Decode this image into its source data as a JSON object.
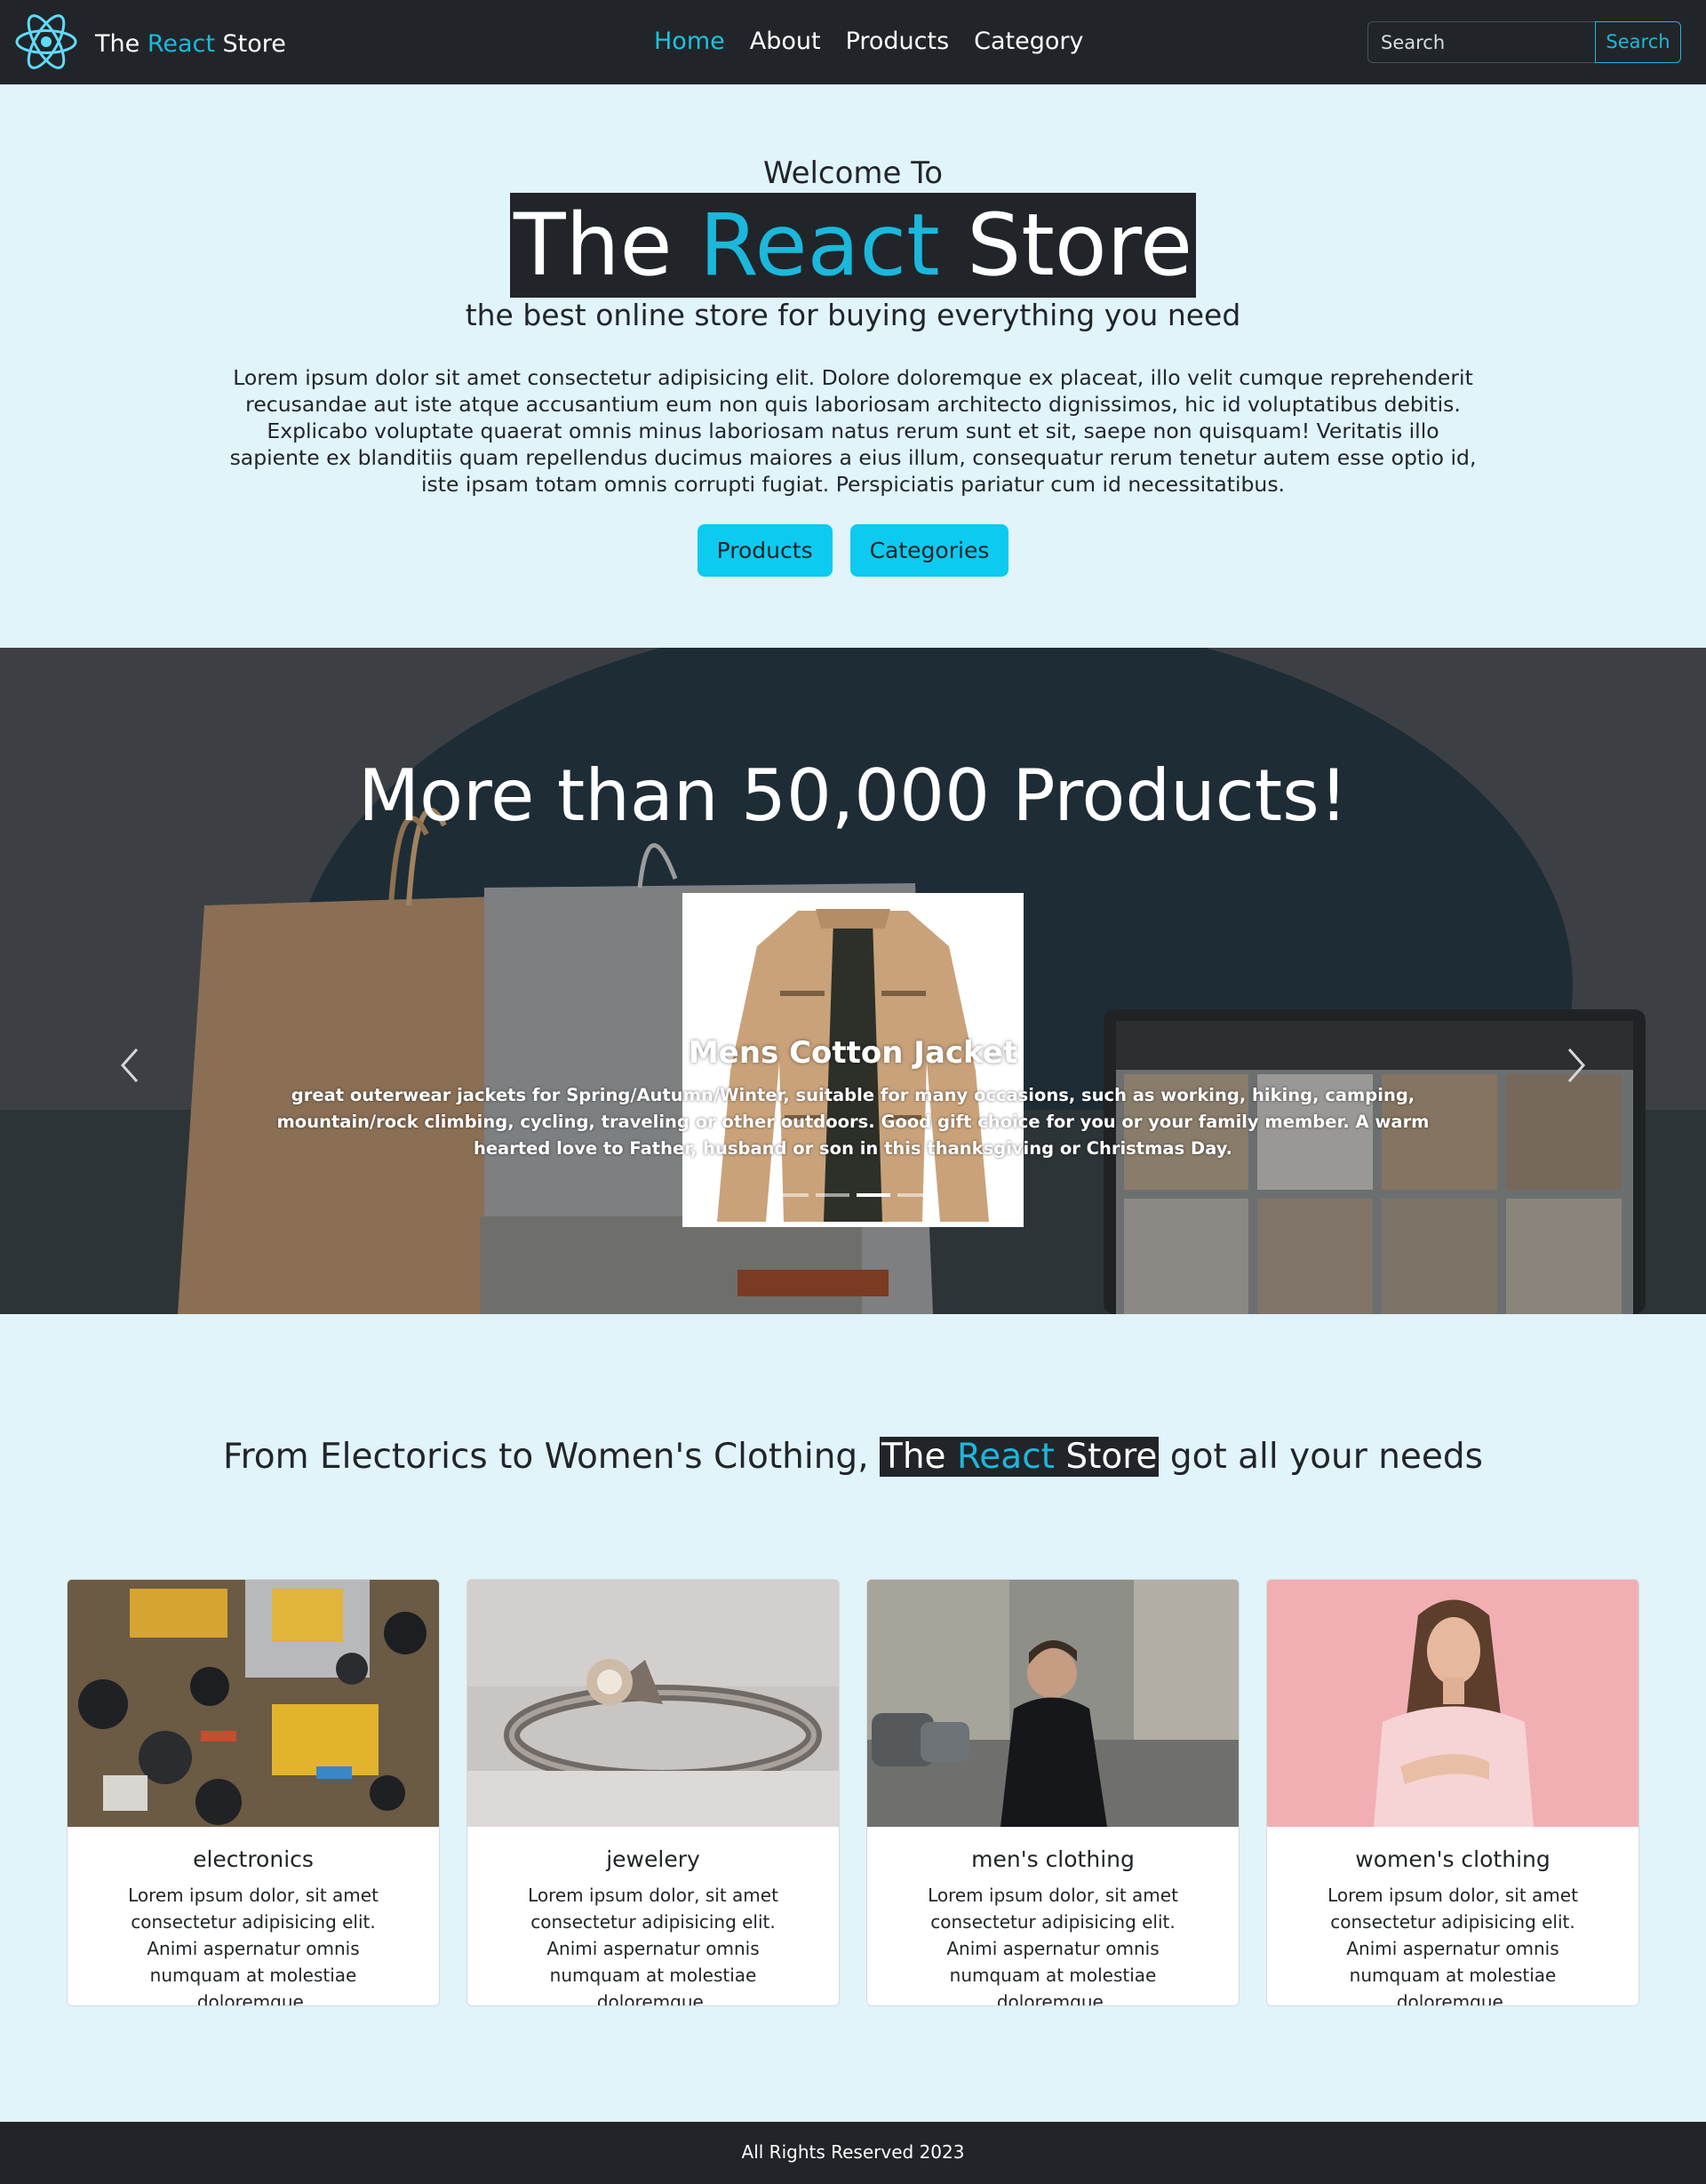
{
  "nav": {
    "brand_prefix": "The",
    "brand_accent": "React",
    "brand_suffix": "Store",
    "links": [
      "Home",
      "About",
      "Products",
      "Category"
    ],
    "search_placeholder": "Search",
    "search_button": "Search"
  },
  "hero": {
    "welcome": "Welcome To",
    "title_prefix": "The",
    "title_accent": "React",
    "title_suffix": "Store",
    "tagline": "the best online store for buying everything you need",
    "body": "Lorem ipsum dolor sit amet consectetur adipisicing elit. Dolore doloremque ex placeat, illo velit cumque reprehenderit recusandae aut iste atque accusantium eum non quis laboriosam architecto dignissimos, hic id voluptatibus debitis. Explicabo voluptate quaerat omnis minus laboriosam natus rerum sunt et sit, saepe non quisquam! Veritatis illo sapiente ex blanditiis quam repellendus ducimus maiores a eius illum, consequatur rerum tenetur autem esse optio id, iste ipsam totam omnis corrupti fugiat. Perspiciatis pariatur cum id necessitatibus.",
    "buttons": [
      "Products",
      "Categories"
    ]
  },
  "showcase": {
    "title": "More than 50,000 Products!",
    "slide_title": "Mens Cotton Jacket",
    "slide_text": "great outerwear jackets for Spring/Autumn/Winter, suitable for many occasions, such as working, hiking, camping, mountain/rock climbing, cycling, traveling or other outdoors. Good gift choice for you or your family member. A warm hearted love to Father, husband or son in this thanksgiving or Christmas Day.",
    "indicators": 4,
    "active_indicator": 3
  },
  "categories": {
    "heading_prefix": "From Electorics to Women's Clothing,",
    "heading_brand_prefix": "The",
    "heading_brand_accent": "React",
    "heading_brand_suffix": "Store",
    "heading_suffix": "got all your needs",
    "items": [
      {
        "title": "electronics",
        "text": "Lorem ipsum dolor, sit amet consectetur adipisicing elit. Animi aspernatur omnis numquam at molestiae doloremque."
      },
      {
        "title": "jewelery",
        "text": "Lorem ipsum dolor, sit amet consectetur adipisicing elit. Animi aspernatur omnis numquam at molestiae doloremque."
      },
      {
        "title": "men's clothing",
        "text": "Lorem ipsum dolor, sit amet consectetur adipisicing elit. Animi aspernatur omnis numquam at molestiae doloremque."
      },
      {
        "title": "women's clothing",
        "text": "Lorem ipsum dolor, sit amet consectetur adipisicing elit. Animi aspernatur omnis numquam at molestiae doloremque."
      }
    ]
  },
  "footer": {
    "text": "All Rights Reserved 2023"
  },
  "colors": {
    "accent": "#1bb8dc",
    "active_nav": "#1bc3dc",
    "button": "#0dcaf0",
    "dark": "#212529",
    "page_bg": "#e0f4f9"
  }
}
